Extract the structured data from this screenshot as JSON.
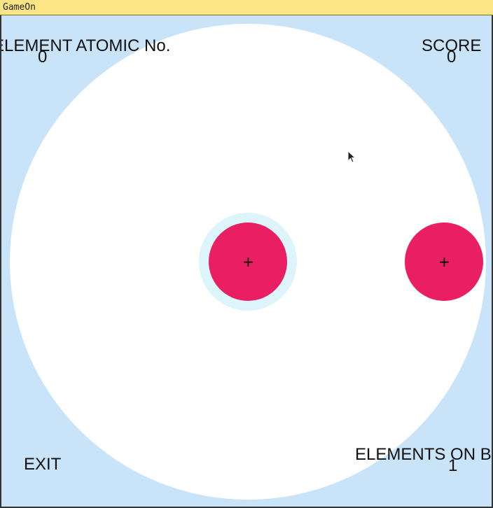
{
  "window": {
    "title": "GameOn"
  },
  "hud": {
    "element_label": "ELEMENT ATOMIC No.",
    "element_value": "0",
    "score_label": "SCORE",
    "score_value": "0",
    "exit_label": "EXIT",
    "elements_label": "ELEMENTS ON BOARD",
    "elements_value": "1"
  },
  "board": {
    "atoms": [
      {
        "symbol": "+",
        "highlighted": true
      },
      {
        "symbol": "+",
        "highlighted": false
      }
    ]
  },
  "colors": {
    "background": "#c9e4f9",
    "arena": "#ffffff",
    "atom": "#e91e63",
    "halo": "#dcf4fa",
    "titlebar": "#fde585"
  }
}
